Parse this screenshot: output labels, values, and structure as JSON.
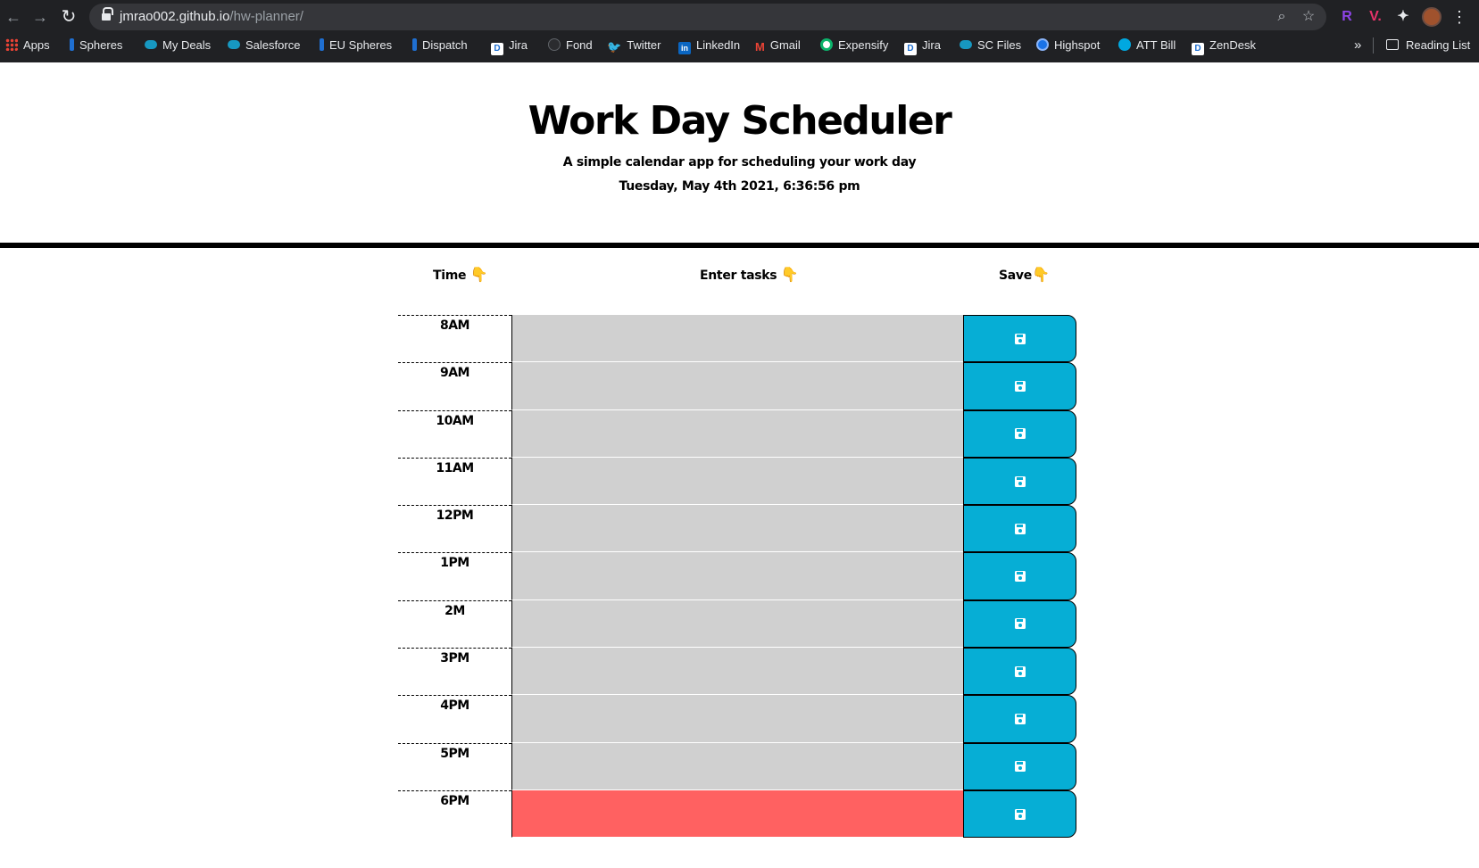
{
  "browser": {
    "url_host": "jmrao002.github.io",
    "url_path": "/hw-planner/",
    "bookmarks": [
      {
        "label": "Apps",
        "icon": "apps-grid-icon"
      },
      {
        "label": "Spheres",
        "icon": "spheres-icon"
      },
      {
        "label": "My Deals",
        "icon": "salesforce-cloud-icon"
      },
      {
        "label": "Salesforce",
        "icon": "salesforce-cloud-icon"
      },
      {
        "label": "EU Spheres",
        "icon": "spheres-icon"
      },
      {
        "label": "Dispatch",
        "icon": "spheres-icon"
      },
      {
        "label": "Jira",
        "icon": "jira-icon"
      },
      {
        "label": "Fond",
        "icon": "fond-icon"
      },
      {
        "label": "Twitter",
        "icon": "twitter-icon"
      },
      {
        "label": "LinkedIn",
        "icon": "linkedin-icon"
      },
      {
        "label": "Gmail",
        "icon": "gmail-icon"
      },
      {
        "label": "Expensify",
        "icon": "expensify-icon"
      },
      {
        "label": "Jira",
        "icon": "jira-icon"
      },
      {
        "label": "SC Files",
        "icon": "salesforce-cloud-icon"
      },
      {
        "label": "Highspot",
        "icon": "highspot-icon"
      },
      {
        "label": "ATT Bill",
        "icon": "att-icon"
      },
      {
        "label": "ZenDesk",
        "icon": "jira-icon"
      }
    ],
    "more_label": "»",
    "reading_list_label": "Reading List"
  },
  "header": {
    "title": "Work Day Scheduler",
    "lead": "A simple calendar app for scheduling your work day",
    "current_date": "Tuesday, May 4th 2021, 6:36:56 pm"
  },
  "columns": {
    "time": "Time",
    "tasks": "Enter tasks",
    "save": "Save",
    "pointer": "👇"
  },
  "hours": [
    {
      "label": "8AM",
      "task": "",
      "state": "past"
    },
    {
      "label": "9AM",
      "task": "",
      "state": "past"
    },
    {
      "label": "10AM",
      "task": "",
      "state": "past"
    },
    {
      "label": "11AM",
      "task": "",
      "state": "past"
    },
    {
      "label": "12PM",
      "task": "",
      "state": "past"
    },
    {
      "label": "1PM",
      "task": "",
      "state": "past"
    },
    {
      "label": "2M",
      "task": "",
      "state": "past"
    },
    {
      "label": "3PM",
      "task": "",
      "state": "past"
    },
    {
      "label": "4PM",
      "task": "",
      "state": "past"
    },
    {
      "label": "5PM",
      "task": "",
      "state": "past"
    },
    {
      "label": "6PM",
      "task": "",
      "state": "present"
    }
  ],
  "colors": {
    "past": "#d0d0d0",
    "present": "#ff6161",
    "save_button": "#06aed5"
  }
}
